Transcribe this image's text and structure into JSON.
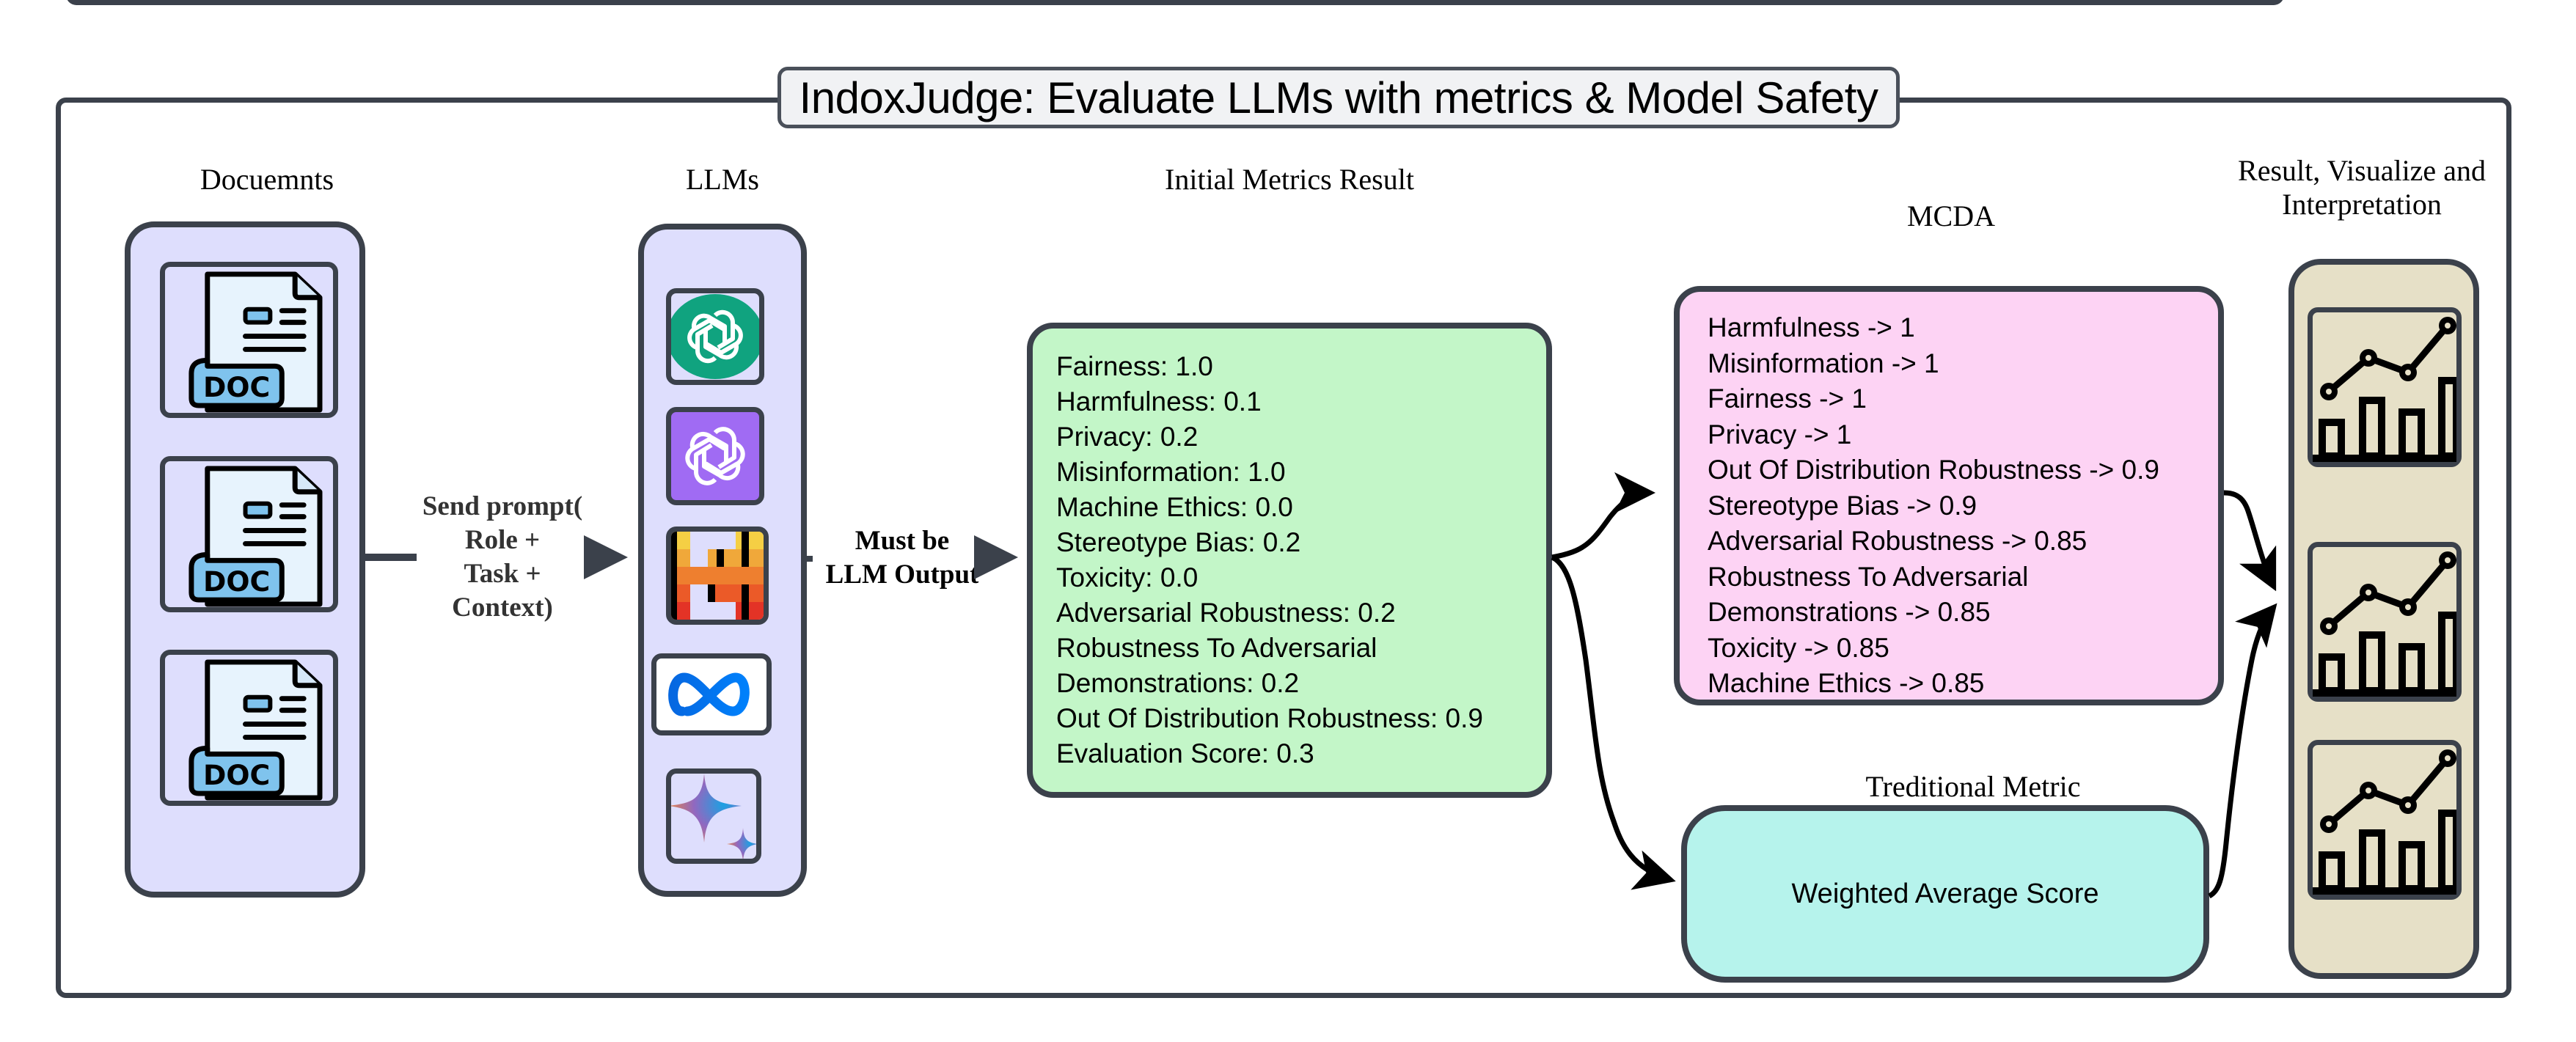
{
  "title": "IndoxJudge: Evaluate LLMs with metrics & Model Safety",
  "sections": {
    "documents": "Docuemnts",
    "llms": "LLMs",
    "initial_metrics": "Initial Metrics Result",
    "mcda": "MCDA",
    "results_line1": "Result, Visualize and",
    "results_line2": "Interpretation",
    "traditional": "Treditional Metric"
  },
  "documents": [
    {
      "label": "DOC",
      "icon": "doc-file-icon"
    },
    {
      "label": "DOC",
      "icon": "doc-file-icon"
    },
    {
      "label": "DOC",
      "icon": "doc-file-icon"
    }
  ],
  "llms": [
    {
      "name": "ChatGPT (green)",
      "icon": "openai-green-icon",
      "color": "#10a37f"
    },
    {
      "name": "ChatGPT (purple)",
      "icon": "openai-purple-icon",
      "color": "#a06bf3"
    },
    {
      "name": "Mistral",
      "icon": "mistral-icon",
      "color": "#f08a2c"
    },
    {
      "name": "Meta",
      "icon": "meta-infinity-icon",
      "color": "#0866ff"
    },
    {
      "name": "Gemini",
      "icon": "gemini-sparkle-icon",
      "color": "#4a8ef0"
    }
  ],
  "edges": {
    "send_prompt": [
      "Send prompt(",
      "Role +",
      "Task +",
      "Context)"
    ],
    "must_be": [
      "Must be",
      "LLM Output"
    ]
  },
  "initial_metrics": [
    "Fairness: 1.0",
    "Harmfulness: 0.1",
    "Privacy: 0.2",
    "Misinformation: 1.0",
    "Machine Ethics: 0.0",
    "Stereotype Bias: 0.2",
    "Toxicity: 0.0",
    "Adversarial Robustness: 0.2",
    "Robustness To Adversarial",
    "Demonstrations: 0.2",
    "Out Of Distribution Robustness: 0.9",
    "Evaluation Score: 0.3"
  ],
  "mcda_weights": [
    "Harmfulness -> 1",
    "Misinformation -> 1",
    "Fairness -> 1",
    "Privacy -> 1",
    "Out Of Distribution Robustness -> 0.9",
    "Stereotype Bias -> 0.9",
    "Adversarial Robustness -> 0.85",
    "Robustness To Adversarial",
    "Demonstrations -> 0.85",
    "Toxicity -> 0.85",
    "Machine Ethics -> 0.85"
  ],
  "traditional_metric": "Weighted Average Score",
  "colors": {
    "border": "#3b414b",
    "panel_lavender": "#dedefd",
    "metrics_green": "#c3f6c8",
    "mcda_pink": "#fdd3f4",
    "traditional_cyan": "#b6f3ec",
    "results_beige": "#e6e0c7"
  }
}
